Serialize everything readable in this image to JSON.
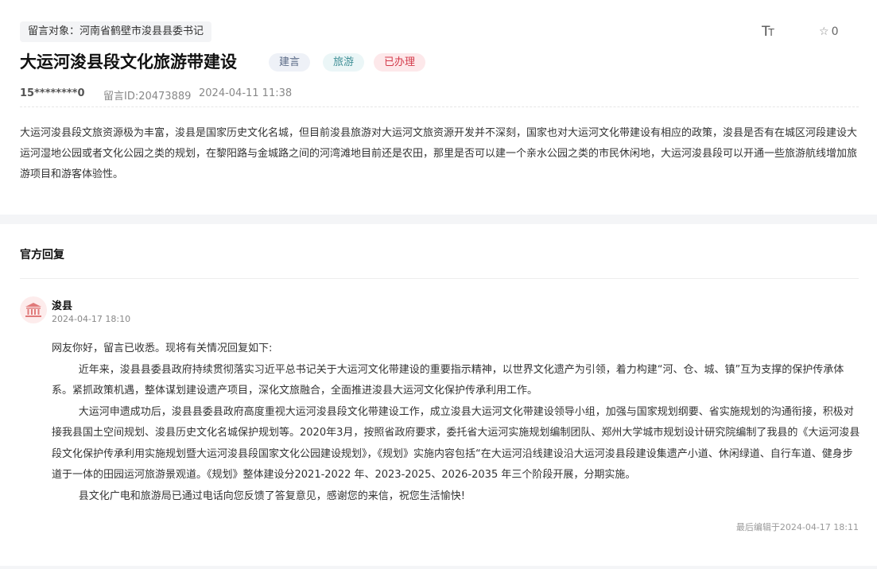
{
  "message": {
    "target_label": "留言对象：",
    "target_value": "河南省鹤壁市浚县县委书记",
    "title": "大运河浚县段文化旅游带建设",
    "badges": [
      "建言",
      "旅游",
      "已办理"
    ],
    "user": "15********0",
    "id_text": "留言ID:20473889",
    "time": "2024-04-11 11:38",
    "font_size_label": "T",
    "font_size_label_small": "T",
    "star_count": "0",
    "content": "大运河浚县段文旅资源极为丰富，浚县是国家历史文化名城，但目前浚县旅游对大运河文旅资源开发并不深刻，国家也对大运河文化带建设有相应的政策，浚县是否有在城区河段建设大运河湿地公园或者文化公园之类的规划，在黎阳路与金城路之间的河湾滩地目前还是农田，那里是否可以建一个亲水公园之类的市民休闲地，大运河浚县段可以开通一些旅游航线增加旅游项目和游客体验性。"
  },
  "reply": {
    "heading": "官方回复",
    "replier": "浚县",
    "time": "2024-04-17 18:10",
    "greeting": "网友你好，留言已收悉。现将有关情况回复如下:",
    "paragraphs": [
      "近年来，浚县县委县政府持续贯彻落实习近平总书记关于大运河文化带建设的重要指示精神，以世界文化遗产为引领，着力构建“河、仓、城、镇”互为支撑的保护传承体系。紧抓政策机遇，整体谋划建设遗产项目，深化文旅融合，全面推进浚县大运河文化保护传承利用工作。",
      "大运河申遗成功后，浚县县委县政府高度重视大运河浚县段文化带建设工作，成立浚县大运河文化带建设领导小组，加强与国家规划纲要、省实施规划的沟通衔接，积极对接我县国土空间规划、浚县历史文化名城保护规划等。2020年3月，按照省政府要求，委托省大运河实施规划编制团队、郑州大学城市规划设计研究院编制了我县的《大运河浚县段文化保护传承利用实施规划暨大运河浚县段国家文化公园建设规划》，《规划》实施内容包括“在大运河沿线建设沿大运河浚县段建设集遗产小道、休闲绿道、自行车道、健身步道于一体的田园运河旅游景观道。《规划》整体建设分2021-2022 年、2023-2025、2026-2035 年三个阶段开展，分期实施。",
      "县文化广电和旅游局已通过电话向您反馈了答复意见，感谢您的来信，祝您生活愉快!"
    ],
    "edited": "最后编辑于2024-04-17 18:11"
  },
  "icons": {
    "font_size": "font-size-icon",
    "star": "star-icon",
    "avatar": "government-building-icon"
  },
  "colors": {
    "badge_suggest": "#5a6a86",
    "badge_tourism": "#3f8f96",
    "badge_done": "#d33a4a"
  }
}
